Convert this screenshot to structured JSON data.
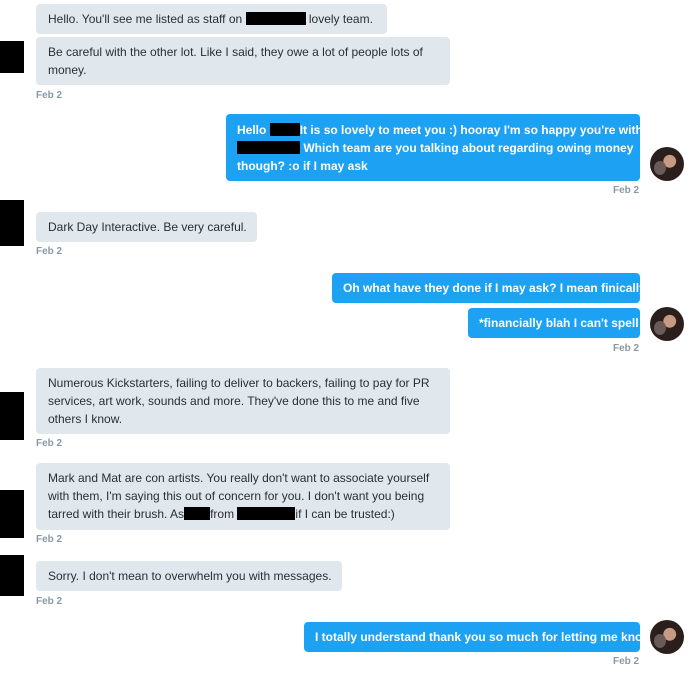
{
  "messages": [
    {
      "id": "m1",
      "dir": "in",
      "lines": [
        [
          "Hello. You'll see me listed as staff on ",
          "",
          "lovely team."
        ]
      ]
    },
    {
      "id": "m2",
      "dir": "in",
      "lines": [
        "Be careful with the other lot. Like I said, they owe a lot of people lots of",
        "money."
      ],
      "time": "Feb 2"
    },
    {
      "id": "m3",
      "dir": "out",
      "line1a": "Hello",
      "line1b": "It is so lovely to meet you :) hooray I'm so happy you're with",
      "line2b": "Which team are you talking about regarding owing money",
      "line3": "though? :o if I may ask",
      "time": "Feb 2"
    },
    {
      "id": "m4",
      "dir": "in",
      "text": "Dark Day Interactive. Be very careful.",
      "time": "Feb 2"
    },
    {
      "id": "m5",
      "dir": "out",
      "text": "Oh what have they done if I may ask? I mean finically"
    },
    {
      "id": "m6",
      "dir": "out",
      "text": "*financially blah I can't spell",
      "time": "Feb 2"
    },
    {
      "id": "m7",
      "dir": "in",
      "lines": [
        "Numerous Kickstarters, failing to deliver to backers, failing to pay for PR",
        "services, art work, sounds and more. They've done this to me and five",
        "others I know."
      ],
      "time": "Feb 2"
    },
    {
      "id": "m8",
      "dir": "in",
      "line1": "Mark and Mat are con artists. You really don't want to associate yourself",
      "line2": "with them, I'm saying this out of concern for you. I don't want you being",
      "line3a": "tarred with their brush. As",
      "line3b": "from",
      "line3c": "if I can be trusted:)",
      "time": "Feb 2"
    },
    {
      "id": "m9",
      "dir": "in",
      "text": "Sorry. I don't mean to overwhelm you with messages.",
      "time": "Feb 2"
    },
    {
      "id": "m10",
      "dir": "out",
      "text": "I totally understand thank you so much for letting me know.",
      "time": "Feb 2"
    }
  ],
  "m1_a": "Hello. You'll see me listed as staff on ",
  "m1_b": "lovely team."
}
